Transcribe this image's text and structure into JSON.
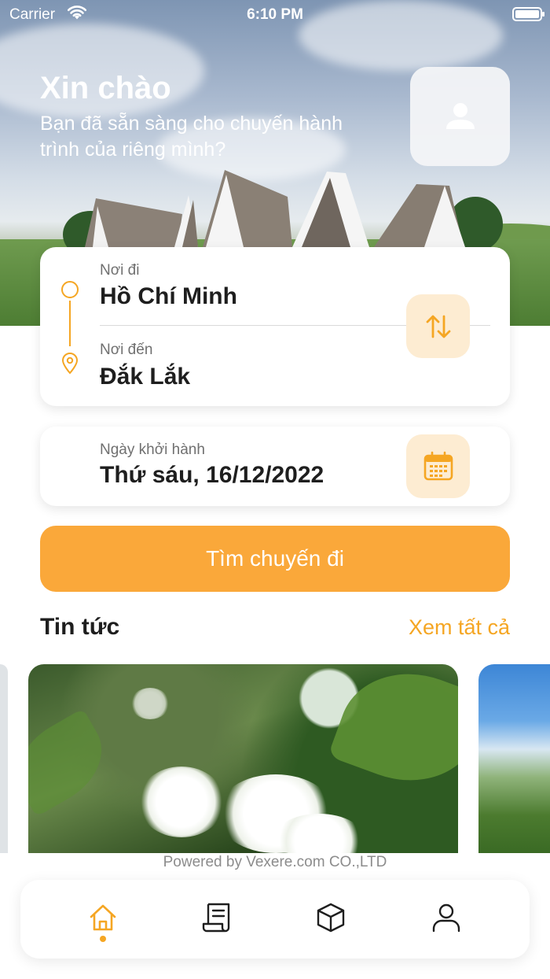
{
  "status_bar": {
    "carrier": "Carrier",
    "time": "6:10 PM"
  },
  "header": {
    "greeting": "Xin chào",
    "subtitle": "Bạn đã sẵn sàng cho chuyến hành trình của riêng mình?",
    "avatar_icon": "user-icon"
  },
  "route": {
    "origin_label": "Nơi đi",
    "origin_value": "Hồ Chí Minh",
    "destination_label": "Nơi đến",
    "destination_value": "Đắk Lắk",
    "swap_icon": "swap-vertical-icon"
  },
  "date": {
    "label": "Ngày khởi hành",
    "value": "Thứ sáu, 16/12/2022",
    "icon": "calendar-icon"
  },
  "search_button": {
    "label": "Tìm chuyến đi"
  },
  "news": {
    "title": "Tin tức",
    "see_all": "Xem tất cả"
  },
  "footer": {
    "powered_by": "Powered by Vexere.com CO.,LTD"
  },
  "tab_bar": {
    "active_tab": "home",
    "tabs": [
      {
        "id": "home",
        "icon": "home-icon"
      },
      {
        "id": "tickets",
        "icon": "receipt-icon"
      },
      {
        "id": "packages",
        "icon": "box-icon"
      },
      {
        "id": "profile",
        "icon": "user-icon"
      }
    ]
  },
  "colors": {
    "accent": "#f5a623",
    "accent_light": "#fdecd2",
    "button": "#faa83a",
    "text_dark": "#1e1e1e",
    "text_muted": "#707070"
  }
}
